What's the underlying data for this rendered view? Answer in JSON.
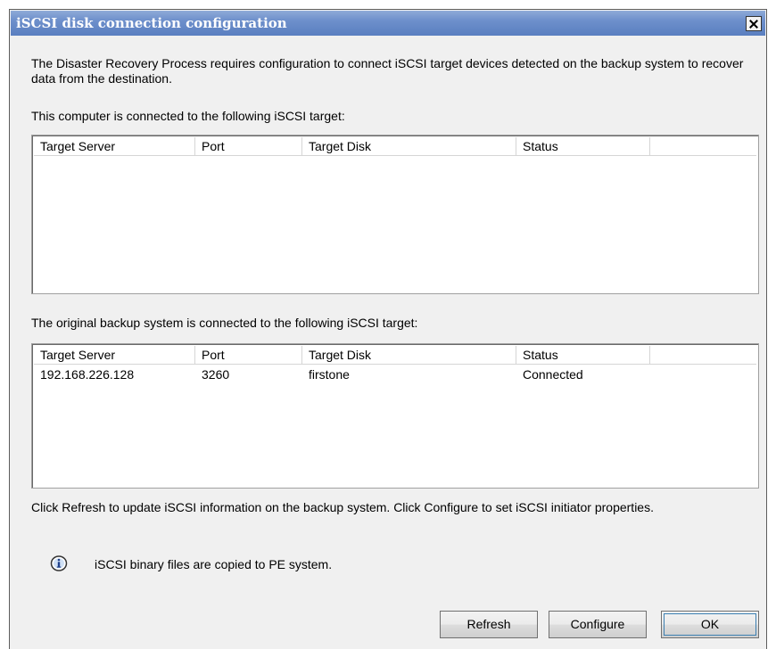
{
  "dialog": {
    "title": "iSCSI disk connection configuration",
    "description": "The Disaster Recovery Process requires configuration to connect iSCSI target devices detected on the backup system to recover data from the destination.",
    "current_label": "This computer is connected to the following iSCSI target:",
    "original_label": "The original backup system is connected to the following iSCSI target:",
    "footer_text": "Click Refresh to update iSCSI information on the backup system. Click Configure to set iSCSI initiator properties.",
    "info_message": "iSCSI binary files are copied to PE system.",
    "info_icon": "info-icon"
  },
  "columns": [
    "Target Server",
    "Port",
    "Target Disk",
    "Status",
    ""
  ],
  "current_targets": [],
  "original_targets": [
    {
      "server": "192.168.226.128",
      "port": "3260",
      "disk": "firstone",
      "status": "Connected"
    }
  ],
  "buttons": {
    "refresh": "Refresh",
    "configure": "Configure",
    "ok": "OK"
  }
}
